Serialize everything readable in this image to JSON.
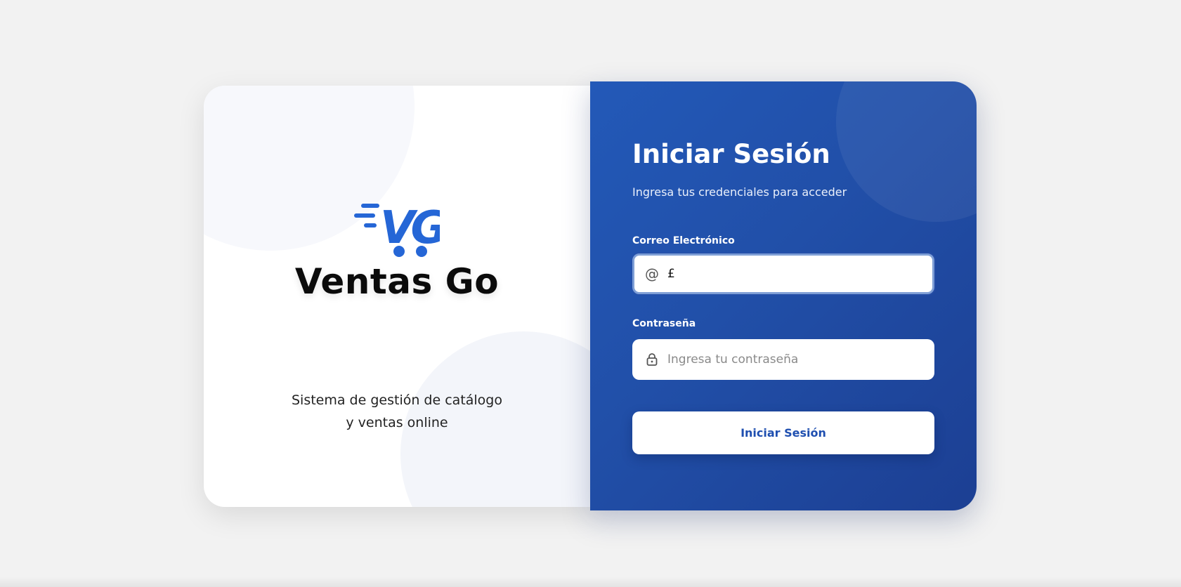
{
  "brand": {
    "name": "Ventas Go",
    "logo_letters": "VG",
    "logo_icon": "cart-icon",
    "accent_color": "#2566d6"
  },
  "tagline": {
    "line1": "Sistema de gestión de catálogo",
    "line2": "y ventas online"
  },
  "login": {
    "title": "Iniciar Sesión",
    "subtitle": "Ingresa tus credenciales para acceder",
    "email": {
      "label": "Correo Electrónico",
      "value": "£",
      "placeholder": "",
      "icon": "at-icon"
    },
    "password": {
      "label": "Contraseña",
      "value": "",
      "placeholder": "Ingresa tu contraseña",
      "icon": "lock-icon"
    },
    "submit_label": "Iniciar Sesión",
    "panel_color": "#214fa8"
  }
}
